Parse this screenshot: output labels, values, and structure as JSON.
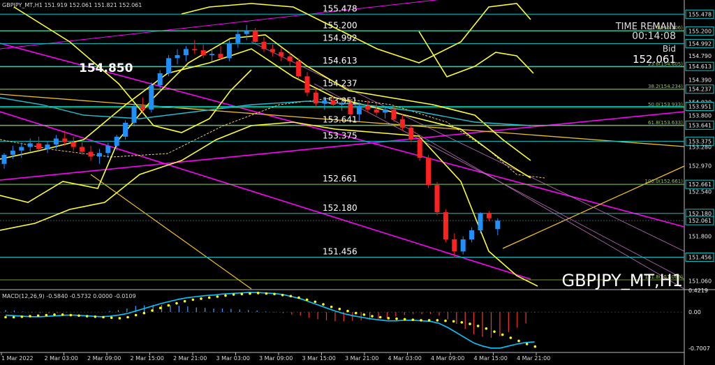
{
  "header": {
    "symbol_line": "GBPJPY_MT,H1  151.919 152.061 151.821 152.061"
  },
  "overlay": {
    "time_remain_label": "TIME REMAIN",
    "time_remain_value": "00:14:08",
    "bid_label": "Bid",
    "bid_value": "152.061",
    "big_level_label": "154.850",
    "watermark": "GBPJPY_MT,H1"
  },
  "colors": {
    "background": "#000000",
    "bull_candle": "#1e90ff",
    "bear_candle": "#ff2020",
    "level_line": "#00c8c8",
    "fib_line": "#9acd32",
    "bollinger": "#ffff33",
    "channel": "#ff00ff",
    "trendline": "#f0c020",
    "macd_line": "#00c8ff",
    "macd_signal": "#ffff00",
    "macd_hist_pos": "#4aa0ff",
    "macd_hist_neg": "#ff3030"
  },
  "chart_data": [
    {
      "type": "candlestick",
      "ylim": [
        150.93,
        155.62
      ],
      "price_scale_labels": [
        "155.478",
        "155.200",
        "154.992",
        "154.790",
        "154.613",
        "154.390",
        "154.237",
        "154.020",
        "153.951",
        "153.800",
        "153.641",
        "153.375",
        "153.280",
        "152.970",
        "152.661",
        "152.540",
        "152.180",
        "152.061",
        "151.800",
        "151.456",
        "151.060"
      ],
      "levels": [
        {
          "value": 155.478,
          "label": "155.478"
        },
        {
          "value": 155.2,
          "label": "155.200"
        },
        {
          "value": 154.992,
          "label": "154.992"
        },
        {
          "value": 154.613,
          "label": "154.613"
        },
        {
          "value": 154.237,
          "label": "154.237"
        },
        {
          "value": 153.951,
          "label": "153.951"
        },
        {
          "value": 153.641,
          "label": "153.641"
        },
        {
          "value": 153.375,
          "label": "153.375"
        },
        {
          "value": 152.661,
          "label": "152.661"
        },
        {
          "value": 152.18,
          "label": "152.180"
        },
        {
          "value": 151.456,
          "label": "151.456"
        }
      ],
      "fib_levels": [
        {
          "value": 155.206,
          "label": "0.0(155.206)"
        },
        {
          "value": 154.605,
          "label": "23.6(154.605)"
        },
        {
          "value": 154.234,
          "label": "38.2(154.234)"
        },
        {
          "value": 153.933,
          "label": "50.0(153.933)"
        },
        {
          "value": 153.633,
          "label": "61.8(153.633)"
        },
        {
          "value": 152.661,
          "label": "100.0(152.661)"
        },
        {
          "value": 151.08,
          "label": "161.8(151.080)"
        }
      ],
      "current_price": 152.061,
      "x_labels": [
        "1 Mar 2022",
        "2 Mar 03:00",
        "2 Mar 09:00",
        "2 Mar 15:00",
        "2 Mar 21:00",
        "3 Mar 03:00",
        "3 Mar 09:00",
        "3 Mar 15:00",
        "3 Mar 21:00",
        "4 Mar 03:00",
        "4 Mar 09:00",
        "4 Mar 15:00",
        "4 Mar 21:00"
      ],
      "candles": [
        [
          153.0,
          153.18,
          152.92,
          153.15
        ],
        [
          153.15,
          153.3,
          153.08,
          153.22
        ],
        [
          153.22,
          153.35,
          153.1,
          153.28
        ],
        [
          153.28,
          153.42,
          153.2,
          153.34
        ],
        [
          153.34,
          153.45,
          153.22,
          153.25
        ],
        [
          153.25,
          153.38,
          153.18,
          153.32
        ],
        [
          153.32,
          153.48,
          153.25,
          153.42
        ],
        [
          153.42,
          153.55,
          153.3,
          153.36
        ],
        [
          153.36,
          153.45,
          153.22,
          153.28
        ],
        [
          153.28,
          153.36,
          153.15,
          153.2
        ],
        [
          153.2,
          153.3,
          153.05,
          153.12
        ],
        [
          153.12,
          153.25,
          153.0,
          153.18
        ],
        [
          153.18,
          153.35,
          153.1,
          153.3
        ],
        [
          153.3,
          153.48,
          153.22,
          153.45
        ],
        [
          153.45,
          153.72,
          153.4,
          153.68
        ],
        [
          153.68,
          154.0,
          153.62,
          153.95
        ],
        [
          153.95,
          154.1,
          153.85,
          153.9
        ],
        [
          153.9,
          154.35,
          153.85,
          154.3
        ],
        [
          154.3,
          154.55,
          154.2,
          154.5
        ],
        [
          154.5,
          154.8,
          154.45,
          154.75
        ],
        [
          154.75,
          154.9,
          154.65,
          154.8
        ],
        [
          154.8,
          154.95,
          154.7,
          154.9
        ],
        [
          154.9,
          155.05,
          154.82,
          154.88
        ],
        [
          154.88,
          154.98,
          154.75,
          154.8
        ],
        [
          154.8,
          154.9,
          154.7,
          154.82
        ],
        [
          154.82,
          154.95,
          154.72,
          154.75
        ],
        [
          154.75,
          155.05,
          154.7,
          155.0
        ],
        [
          155.0,
          155.22,
          154.92,
          155.15
        ],
        [
          155.15,
          155.3,
          155.05,
          155.2
        ],
        [
          155.2,
          155.25,
          155.0,
          155.02
        ],
        [
          155.02,
          155.1,
          154.85,
          154.9
        ],
        [
          154.9,
          154.98,
          154.78,
          154.85
        ],
        [
          154.85,
          154.92,
          154.7,
          154.78
        ],
        [
          154.78,
          154.85,
          154.62,
          154.7
        ],
        [
          154.7,
          154.75,
          154.4,
          154.45
        ],
        [
          154.45,
          154.52,
          154.12,
          154.18
        ],
        [
          154.18,
          154.25,
          153.95,
          154.0
        ],
        [
          154.0,
          154.1,
          153.9,
          154.05
        ],
        [
          154.05,
          154.12,
          153.92,
          153.98
        ],
        [
          153.98,
          154.08,
          153.88,
          154.0
        ],
        [
          154.0,
          154.06,
          153.78,
          153.82
        ],
        [
          153.82,
          154.02,
          153.7,
          153.96
        ],
        [
          153.96,
          154.05,
          153.85,
          153.9
        ],
        [
          153.9,
          154.0,
          153.8,
          153.85
        ],
        [
          153.85,
          153.95,
          153.75,
          153.9
        ],
        [
          153.9,
          153.96,
          153.7,
          153.74
        ],
        [
          153.74,
          153.82,
          153.55,
          153.6
        ],
        [
          153.6,
          153.65,
          153.35,
          153.4
        ],
        [
          153.4,
          153.45,
          153.05,
          153.1
        ],
        [
          153.1,
          153.15,
          152.6,
          152.65
        ],
        [
          152.65,
          152.7,
          152.15,
          152.2
        ],
        [
          152.2,
          152.25,
          151.7,
          151.75
        ],
        [
          151.75,
          151.85,
          151.45,
          151.55
        ],
        [
          151.55,
          151.8,
          151.5,
          151.75
        ],
        [
          151.75,
          151.95,
          151.7,
          151.9
        ],
        [
          151.9,
          152.2,
          151.85,
          152.18
        ],
        [
          152.18,
          152.22,
          152.05,
          152.1
        ],
        [
          151.92,
          152.1,
          151.82,
          152.06
        ]
      ]
    },
    {
      "type": "macd",
      "title": "MACD(12,26,9) -0.5840 -0.5732 0.0000 -0.0109",
      "params": "12,26,9",
      "values": [
        -0.584,
        -0.5732,
        0.0,
        -0.0109
      ],
      "ylim": [
        -0.7707,
        0.4219
      ],
      "scale_labels": [
        "0.4219",
        "0.00",
        "-0.7007"
      ],
      "signal_dots": [
        -0.1,
        -0.1,
        -0.09,
        -0.08,
        -0.07,
        -0.06,
        -0.05,
        -0.05,
        -0.06,
        -0.07,
        -0.08,
        -0.09,
        -0.1,
        -0.11,
        -0.12,
        -0.1,
        -0.06,
        -0.02,
        0.03,
        0.08,
        0.13,
        0.17,
        0.21,
        0.24,
        0.26,
        0.28,
        0.3,
        0.32,
        0.34,
        0.35,
        0.36,
        0.37,
        0.36,
        0.35,
        0.33,
        0.31,
        0.28,
        0.24,
        0.2,
        0.15,
        0.1,
        0.06,
        0.02,
        -0.02,
        -0.05,
        -0.08,
        -0.1,
        -0.12,
        -0.13,
        -0.14,
        -0.15,
        -0.16,
        -0.16,
        -0.16,
        -0.17,
        -0.18,
        -0.2,
        -0.23,
        -0.27,
        -0.32,
        -0.38,
        -0.44,
        -0.5,
        -0.56,
        -0.62,
        -0.67
      ],
      "macd_line": [
        -0.06,
        -0.07,
        -0.08,
        -0.09,
        -0.09,
        -0.08,
        -0.07,
        -0.06,
        -0.06,
        -0.07,
        -0.08,
        -0.09,
        -0.08,
        -0.06,
        -0.03,
        0.02,
        0.07,
        0.12,
        0.17,
        0.21,
        0.25,
        0.28,
        0.3,
        0.32,
        0.33,
        0.35,
        0.36,
        0.37,
        0.38,
        0.38,
        0.37,
        0.36,
        0.34,
        0.3,
        0.26,
        0.2,
        0.14,
        0.08,
        0.02,
        -0.03,
        -0.07,
        -0.1,
        -0.13,
        -0.15,
        -0.17,
        -0.17,
        -0.16,
        -0.16,
        -0.17,
        -0.18,
        -0.22,
        -0.3,
        -0.4,
        -0.5,
        -0.6,
        -0.66,
        -0.7,
        -0.7,
        -0.66,
        -0.62,
        -0.59,
        -0.58
      ],
      "histogram": [
        0.04,
        0.03,
        0.01,
        -0.01,
        -0.02,
        -0.02,
        -0.02,
        -0.01,
        0.0,
        0.0,
        0.0,
        0.0,
        0.02,
        0.04,
        0.07,
        0.12,
        0.13,
        0.14,
        0.14,
        0.13,
        0.12,
        0.11,
        0.09,
        0.08,
        0.07,
        0.07,
        0.06,
        0.05,
        0.04,
        0.03,
        0.01,
        -0.01,
        -0.02,
        -0.05,
        -0.07,
        -0.11,
        -0.14,
        -0.16,
        -0.18,
        -0.18,
        -0.17,
        -0.16,
        -0.15,
        -0.13,
        -0.12,
        -0.09,
        -0.06,
        -0.04,
        -0.04,
        -0.04,
        -0.07,
        -0.14,
        -0.23,
        -0.33,
        -0.43,
        -0.48,
        -0.5,
        -0.47,
        -0.39,
        -0.3,
        -0.22,
        -0.01
      ]
    }
  ]
}
